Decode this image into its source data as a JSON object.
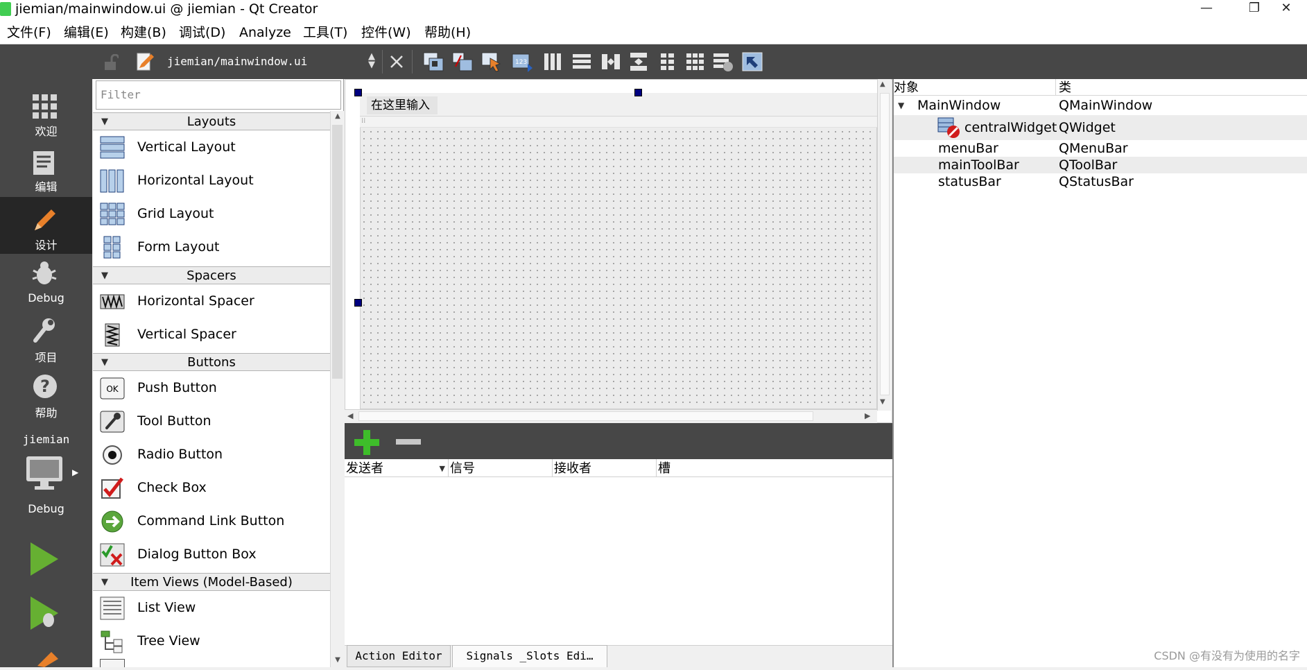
{
  "window": {
    "title": "jiemian/mainwindow.ui @ jiemian - Qt Creator",
    "controls": [
      "—",
      "❐",
      "✕"
    ]
  },
  "menubar": {
    "items": [
      "文件(F)",
      "编辑(E)",
      "构建(B)",
      "调试(D)",
      "Analyze",
      "工具(T)",
      "控件(W)",
      "帮助(H)"
    ]
  },
  "modes": [
    {
      "label": "欢迎",
      "icon": "welcome-grid-icon"
    },
    {
      "label": "编辑",
      "icon": "edit-document-icon"
    },
    {
      "label": "设计",
      "icon": "design-pencil-icon",
      "active": true
    },
    {
      "label": "Debug",
      "icon": "debug-bug-icon"
    },
    {
      "label": "项目",
      "icon": "project-wrench-icon"
    },
    {
      "label": "帮助",
      "icon": "help-question-icon"
    }
  ],
  "kit": {
    "project": "jiemian",
    "config": "Debug"
  },
  "toolbar": {
    "file_path": "jiemian/mainwindow.ui"
  },
  "widgetbox": {
    "filter_placeholder": "Filter",
    "categories": {
      "layouts": "Layouts",
      "spacers": "Spacers",
      "buttons": "Buttons",
      "item_views": "Item Views (Model-Based)"
    },
    "items": {
      "vertical_layout": "Vertical Layout",
      "horizontal_layout": "Horizontal Layout",
      "grid_layout": "Grid Layout",
      "form_layout": "Form Layout",
      "horizontal_spacer": "Horizontal Spacer",
      "vertical_spacer": "Vertical Spacer",
      "push_button": "Push Button",
      "tool_button": "Tool Button",
      "radio_button": "Radio Button",
      "check_box": "Check Box",
      "command_link_button": "Command Link Button",
      "dialog_button_box": "Dialog Button Box",
      "list_view": "List View",
      "tree_view": "Tree View"
    },
    "push_button_icon_text": "OK"
  },
  "form": {
    "menu_placeholder": "在这里输入"
  },
  "signals": {
    "columns": [
      "发送者",
      "信号",
      "接收者",
      "槽"
    ],
    "tabs": [
      "Action Editor",
      "Signals _Slots Edi…"
    ]
  },
  "inspector": {
    "headers": [
      "对象",
      "类"
    ],
    "rows": [
      {
        "object": "MainWindow",
        "class": "QMainWindow"
      },
      {
        "object": "centralWidget",
        "class": "QWidget"
      },
      {
        "object": "menuBar",
        "class": "QMenuBar"
      },
      {
        "object": "mainToolBar",
        "class": "QToolBar"
      },
      {
        "object": "statusBar",
        "class": "QStatusBar"
      }
    ]
  },
  "watermark": "CSDN @有没有为使用的名字",
  "colors": {
    "dark_panel": "#474747",
    "active_mode": "#262626",
    "run_green": "#66b032",
    "handle": "#000080"
  }
}
